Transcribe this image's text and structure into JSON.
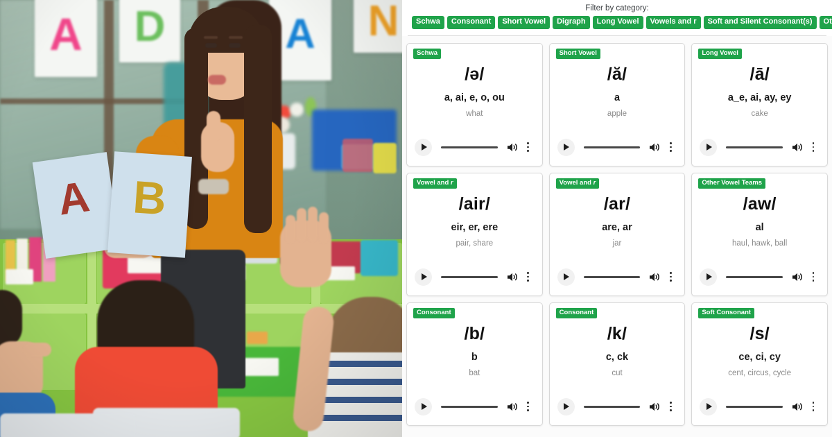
{
  "photo": {
    "alt": "classroom-teacher-reading-alphabet-book-to-children",
    "wall_posters": [
      {
        "letter": "A",
        "color": "#f0468a"
      },
      {
        "letter": "D",
        "color": "#6cbf5e"
      },
      {
        "letter": "A",
        "color": "#1782d4"
      },
      {
        "letter": "N",
        "color": "#f0a227"
      }
    ],
    "book_letters": [
      {
        "letter": "A",
        "color": "#a23a2e"
      },
      {
        "letter": "B",
        "color": "#c9a227"
      }
    ]
  },
  "filters": {
    "label": "Filter by category:",
    "chips": [
      "Schwa",
      "Consonant",
      "Short Vowel",
      "Digraph",
      "Long Vowel",
      "Vowels and r",
      "Soft and Silent Consonant(s)",
      "Other Vowel Teams"
    ]
  },
  "player": {
    "play_label": "play-button",
    "volume_label": "volume-button",
    "menu_label": "more-options"
  },
  "colors": {
    "accent_green": "#1fa34a",
    "card_border": "#d8d8d8",
    "example_text": "#8a8a8a"
  },
  "cards": [
    {
      "badge": "Schwa",
      "badge_italic_tail": "",
      "phoneme": "/ə/",
      "graphemes": "a, ai, e, o, ou",
      "example": "what"
    },
    {
      "badge": "Short Vowel",
      "badge_italic_tail": "",
      "phoneme": "/ă/",
      "graphemes": "a",
      "example": "apple"
    },
    {
      "badge": "Long Vowel",
      "badge_italic_tail": "",
      "phoneme": "/ā/",
      "graphemes": "a_e, ai, ay, ey",
      "example": "cake"
    },
    {
      "badge": "Vowel and ",
      "badge_italic_tail": "r",
      "phoneme": "/air/",
      "graphemes": "eir, er, ere",
      "example": "pair, share"
    },
    {
      "badge": "Vowel and ",
      "badge_italic_tail": "r",
      "phoneme": "/ar/",
      "graphemes": "are, ar",
      "example": "jar"
    },
    {
      "badge": "Other Vowel Teams",
      "badge_italic_tail": "",
      "phoneme": "/aw/",
      "graphemes": "al",
      "example": "haul, hawk, ball"
    },
    {
      "badge": "Consonant",
      "badge_italic_tail": "",
      "phoneme": "/b/",
      "graphemes": "b",
      "example": "bat"
    },
    {
      "badge": "Consonant",
      "badge_italic_tail": "",
      "phoneme": "/k/",
      "graphemes": "c, ck",
      "example": "cut"
    },
    {
      "badge": "Soft Consonant",
      "badge_italic_tail": "",
      "phoneme": "/s/",
      "graphemes": "ce, ci, cy",
      "example": "cent, circus, cycle"
    }
  ]
}
